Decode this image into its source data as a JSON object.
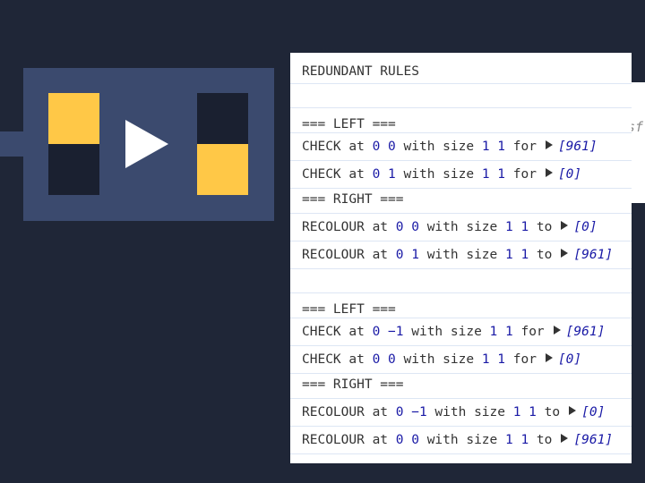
{
  "colors": {
    "background": "#1f2637",
    "preview_bg": "#3b4a6e",
    "yellow": "#ffc847",
    "dark": "#1a2030",
    "number": "#1a1aa6"
  },
  "preview": {
    "icon": "play-arrow-icon"
  },
  "ghost_text": "sf",
  "title": "REDUNDANT RULES",
  "sections": [
    {
      "left_header": "=== LEFT ===",
      "left": [
        {
          "cmd": "CHECK",
          "at": "at",
          "pos": [
            "0",
            "0"
          ],
          "with": "with size",
          "size": [
            "1",
            "1"
          ],
          "kw": "for",
          "color": "[961]"
        },
        {
          "cmd": "CHECK",
          "at": "at",
          "pos": [
            "0",
            "1"
          ],
          "with": "with size",
          "size": [
            "1",
            "1"
          ],
          "kw": "for",
          "color": "[0]"
        }
      ],
      "right_header": "=== RIGHT ===",
      "right": [
        {
          "cmd": "RECOLOUR",
          "at": "at",
          "pos": [
            "0",
            "0"
          ],
          "with": "with size",
          "size": [
            "1",
            "1"
          ],
          "kw": "to",
          "color": "[0]"
        },
        {
          "cmd": "RECOLOUR",
          "at": "at",
          "pos": [
            "0",
            "1"
          ],
          "with": "with size",
          "size": [
            "1",
            "1"
          ],
          "kw": "to",
          "color": "[961]"
        }
      ]
    },
    {
      "left_header": "=== LEFT ===",
      "left": [
        {
          "cmd": "CHECK",
          "at": "at",
          "pos": [
            "0",
            "−1"
          ],
          "with": "with size",
          "size": [
            "1",
            "1"
          ],
          "kw": "for",
          "color": "[961]"
        },
        {
          "cmd": "CHECK",
          "at": "at",
          "pos": [
            "0",
            "0"
          ],
          "with": "with size",
          "size": [
            "1",
            "1"
          ],
          "kw": "for",
          "color": "[0]"
        }
      ],
      "right_header": "=== RIGHT ===",
      "right": [
        {
          "cmd": "RECOLOUR",
          "at": "at",
          "pos": [
            "0",
            "−1"
          ],
          "with": "with size",
          "size": [
            "1",
            "1"
          ],
          "kw": "to",
          "color": "[0]"
        },
        {
          "cmd": "RECOLOUR",
          "at": "at",
          "pos": [
            "0",
            "0"
          ],
          "with": "with size",
          "size": [
            "1",
            "1"
          ],
          "kw": "to",
          "color": "[961]"
        }
      ]
    }
  ]
}
